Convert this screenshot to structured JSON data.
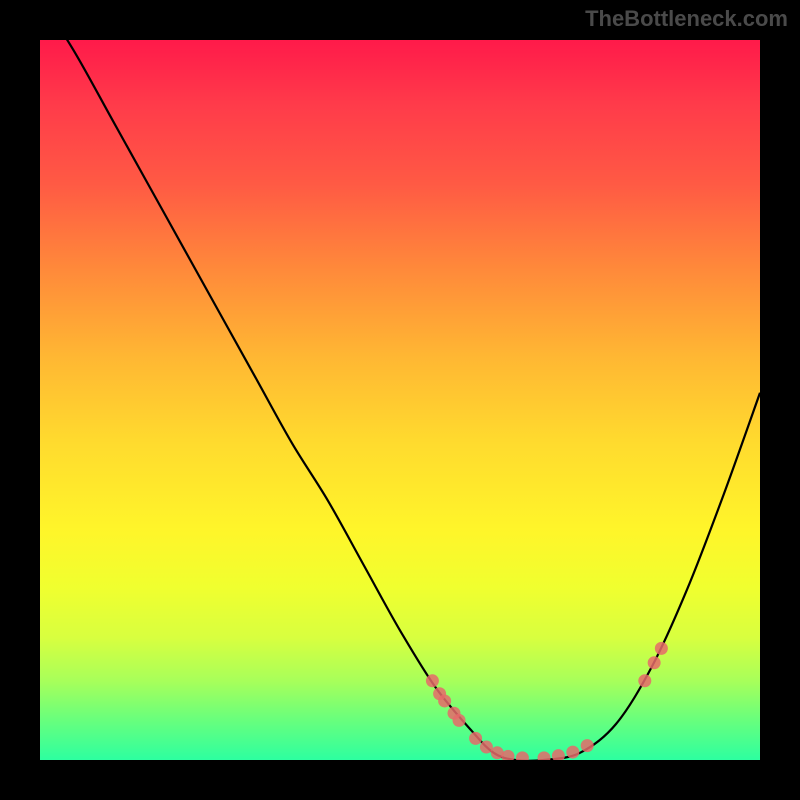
{
  "watermark": "TheBottleneck.com",
  "chart_data": {
    "type": "line",
    "title": "",
    "xlabel": "",
    "ylabel": "",
    "xlim": [
      0,
      100
    ],
    "ylim": [
      0,
      100
    ],
    "series": [
      {
        "name": "curve",
        "x": [
          0,
          5,
          10,
          15,
          20,
          25,
          30,
          35,
          40,
          45,
          50,
          55,
          60,
          63,
          66,
          70,
          75,
          80,
          85,
          90,
          95,
          100
        ],
        "y": [
          106,
          98,
          89,
          80,
          71,
          62,
          53,
          44,
          36,
          27,
          18,
          10,
          4,
          1,
          0,
          0,
          1,
          5,
          13,
          24,
          37,
          51
        ]
      }
    ],
    "markers": [
      {
        "x": 54.5,
        "y": 11
      },
      {
        "x": 55.5,
        "y": 9.2
      },
      {
        "x": 56.2,
        "y": 8.2
      },
      {
        "x": 57.5,
        "y": 6.5
      },
      {
        "x": 58.2,
        "y": 5.5
      },
      {
        "x": 60.5,
        "y": 3
      },
      {
        "x": 62,
        "y": 1.8
      },
      {
        "x": 63.5,
        "y": 1
      },
      {
        "x": 65,
        "y": 0.5
      },
      {
        "x": 67,
        "y": 0.3
      },
      {
        "x": 70,
        "y": 0.3
      },
      {
        "x": 72,
        "y": 0.6
      },
      {
        "x": 74,
        "y": 1.1
      },
      {
        "x": 76,
        "y": 2
      },
      {
        "x": 84,
        "y": 11
      },
      {
        "x": 85.3,
        "y": 13.5
      },
      {
        "x": 86.3,
        "y": 15.5
      }
    ],
    "marker_color": "#e66a6a",
    "curve_color": "#000000",
    "axes_visible": false,
    "grid": false
  }
}
